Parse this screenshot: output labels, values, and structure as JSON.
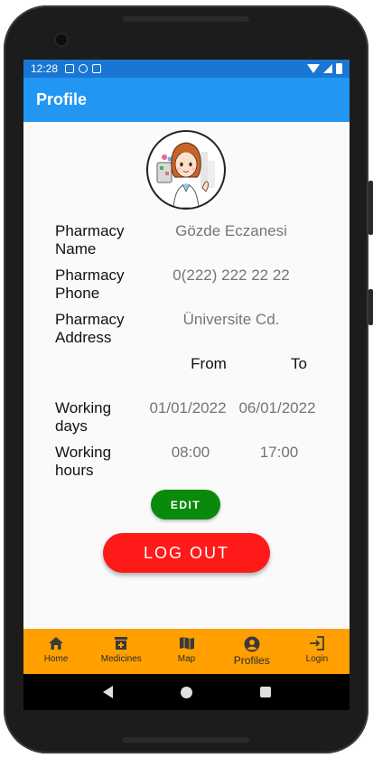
{
  "status_bar": {
    "time": "12:28"
  },
  "app_bar": {
    "title": "Profile"
  },
  "profile": {
    "pharmacy_name_label_1": "Pharmacy",
    "pharmacy_name_label_2": "Name",
    "pharmacy_name_value": "Gözde Eczanesi",
    "pharmacy_phone_label_1": "Pharmacy",
    "pharmacy_phone_label_2": "Phone",
    "pharmacy_phone_value": "0(222) 222 22 22",
    "pharmacy_address_label_1": "Pharmacy",
    "pharmacy_address_label_2": "Address",
    "pharmacy_address_value": "Üniversite Cd.",
    "from_header": "From",
    "to_header": "To",
    "working_days_label_1": "Working",
    "working_days_label_2": "days",
    "working_days_from": "01/01/2022",
    "working_days_to": "06/01/2022",
    "working_hours_label_1": "Working",
    "working_hours_label_2": "hours",
    "working_hours_from": "08:00",
    "working_hours_to": "17:00"
  },
  "buttons": {
    "edit": "EDIT",
    "logout": "LOG OUT"
  },
  "bottom_nav": {
    "items": [
      {
        "label": "Home",
        "icon": "home-icon"
      },
      {
        "label": "Medicines",
        "icon": "medicine-box-icon"
      },
      {
        "label": "Map",
        "icon": "map-icon"
      },
      {
        "label": "Profiles",
        "icon": "account-circle-icon"
      },
      {
        "label": "Login",
        "icon": "login-icon"
      }
    ]
  },
  "colors": {
    "app_bar": "#2196f3",
    "status_bar": "#1976d2",
    "bottom_nav": "#ffa000",
    "edit_button": "#0a8a0a",
    "logout_button": "#ff1a1a"
  }
}
